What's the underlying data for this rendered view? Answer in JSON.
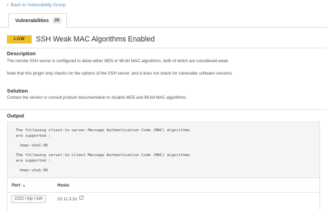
{
  "nav": {
    "back_label": "Back to Vulnerability Group",
    "back_icon": "chevron-left-icon"
  },
  "tabs": [
    {
      "label": "Vulnerabilities",
      "count": "26"
    }
  ],
  "vulnerability": {
    "severity": "LOW",
    "severity_color": "#f2c02f",
    "title": "SSH Weak MAC Algorithms Enabled"
  },
  "description": {
    "heading": "Description",
    "line1": "The remote SSH server is configured to allow either MD5 or 96-bit MAC algorithms, both of which are considered weak.",
    "line2": "Note that this plugin only checks for the options of the SSH server, and it does not check for vulnerable software versions."
  },
  "solution": {
    "heading": "Solution",
    "text": "Contact the vendor or consult product documentation to disable MD5 and 96-bit MAC algorithms."
  },
  "output": {
    "heading": "Output",
    "lines": [
      "The following client-to-server Message Authentication Code (MAC) algorithms",
      "are supported :",
      "hmac-sha1-96",
      "The following server-to-client Message Authentication Code (MAC) algorithms",
      "are supported :",
      "hmac-sha1-96"
    ]
  },
  "ports_table": {
    "col_port": "Port",
    "col_hosts": "Hosts",
    "rows": [
      {
        "port": "2222 / tcp / ssh",
        "host": "10.11.3.31"
      }
    ]
  }
}
